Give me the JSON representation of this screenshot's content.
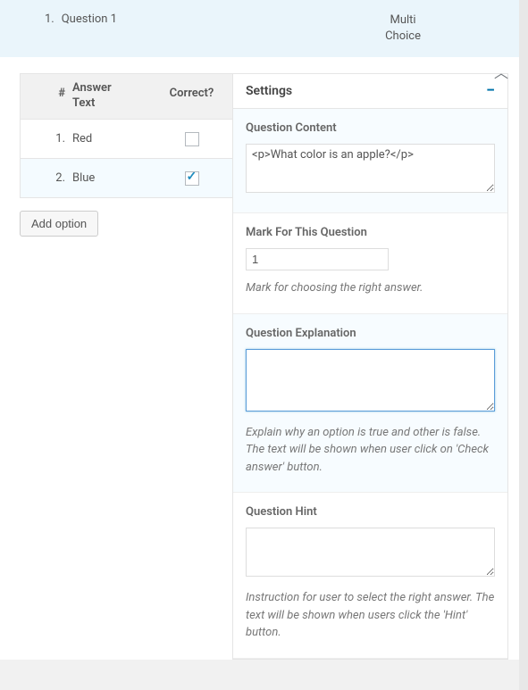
{
  "question": {
    "number": "1.",
    "title": "Question 1",
    "type_line1": "Multi",
    "type_line2": "Choice"
  },
  "answers_table": {
    "head_num": "#",
    "head_answer_l1": "Answer",
    "head_answer_l2": "Text",
    "head_correct": "Correct?",
    "rows": [
      {
        "num": "1.",
        "text": "Red",
        "checked": false
      },
      {
        "num": "2.",
        "text": "Blue",
        "checked": true
      }
    ]
  },
  "buttons": {
    "add_option": "Add option"
  },
  "settings": {
    "title": "Settings",
    "content": {
      "label": "Question Content",
      "value": "<p>What color is an apple?</p>"
    },
    "mark": {
      "label": "Mark For This Question",
      "value": "1",
      "help": "Mark for choosing the right answer."
    },
    "explanation": {
      "label": "Question Explanation",
      "value": "",
      "help": "Explain why an option is true and other is false. The text will be shown when user click on 'Check answer' button."
    },
    "hint": {
      "label": "Question Hint",
      "value": "",
      "help": "Instruction for user to select the right answer. The text will be shown when users click the 'Hint' button."
    }
  }
}
